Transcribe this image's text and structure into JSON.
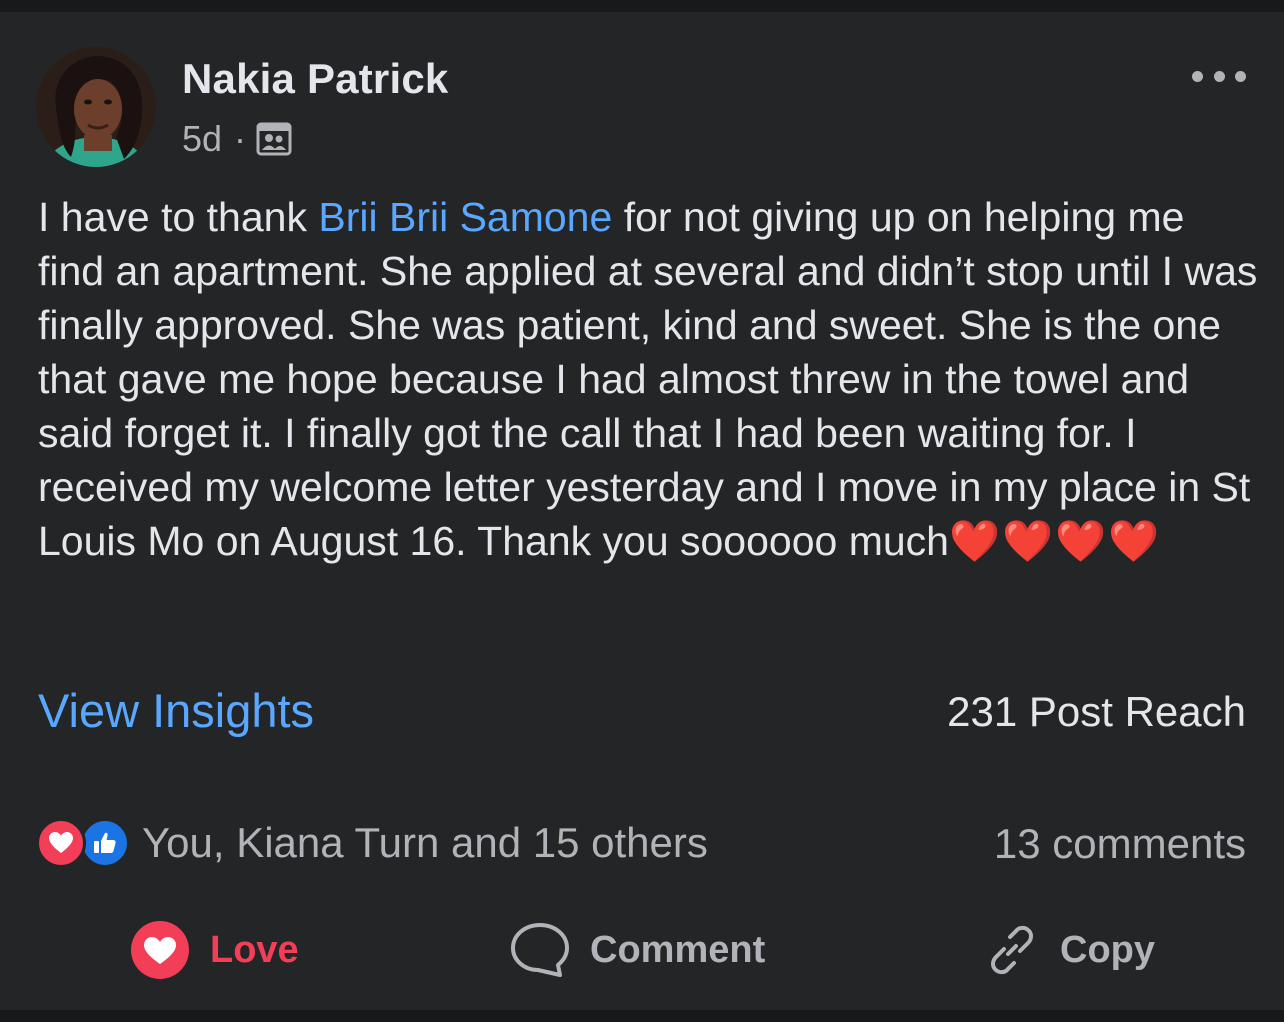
{
  "post": {
    "author": "Nakia Patrick",
    "time": "5d",
    "separator": "·",
    "audience_icon": "friends-icon",
    "body_before": "I have to thank ",
    "mention": "Brii Brii Samone",
    "body_after": " for not giving up on helping me find an apartment.  She applied at several and didn’t stop until I was finally approved. She was patient, kind and sweet. She is the one that gave me hope because I  had almost threw in the towel and said forget it. I finally got the call that I had been waiting for. I received my welcome letter yesterday and I move in my place in St Louis Mo on August 16. Thank you soooooo much",
    "hearts": "❤️❤️❤️❤️"
  },
  "insights": {
    "link_label": "View Insights",
    "reach": "231 Post Reach"
  },
  "reactions": {
    "summary": "You, Kiana Turn and 15 others",
    "comments": "13 comments"
  },
  "actions": {
    "love": "Love",
    "comment": "Comment",
    "copy": "Copy"
  },
  "colors": {
    "background": "#242526",
    "link": "#5aa7ff",
    "love": "#f33e58",
    "like": "#1b74e4",
    "muted": "#b0b3b8"
  }
}
